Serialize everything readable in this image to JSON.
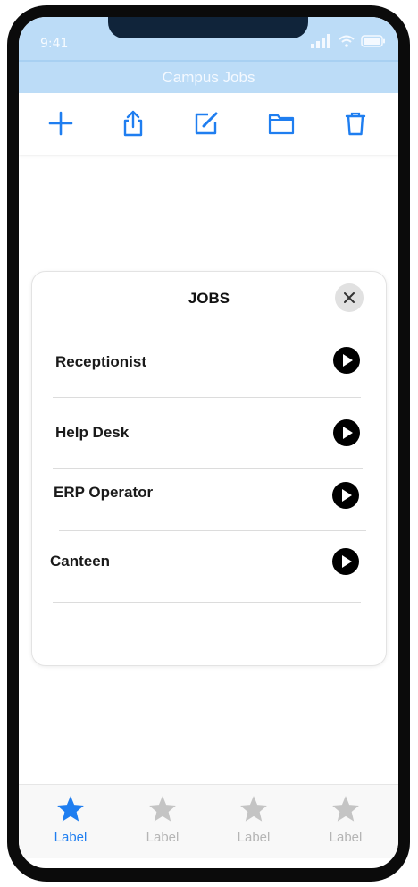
{
  "status": {
    "time": "9:41"
  },
  "navbar": {
    "title": "Campus Jobs"
  },
  "toolbar": {
    "icons": [
      "plus-icon",
      "share-icon",
      "compose-icon",
      "folder-icon",
      "trash-icon"
    ]
  },
  "card": {
    "title": "JOBS",
    "jobs": [
      {
        "label": "Receptionist"
      },
      {
        "label": "Help Desk"
      },
      {
        "label": "ERP Operator"
      },
      {
        "label": "Canteen"
      }
    ]
  },
  "tabbar": {
    "tabs": [
      {
        "label": "Label",
        "active": true
      },
      {
        "label": "Label",
        "active": false
      },
      {
        "label": "Label",
        "active": false
      },
      {
        "label": "Label",
        "active": false
      }
    ]
  },
  "colors": {
    "accent": "#1f7ef0",
    "inactive": "#c4c4c4",
    "header_bg": "#bcdcf7"
  }
}
